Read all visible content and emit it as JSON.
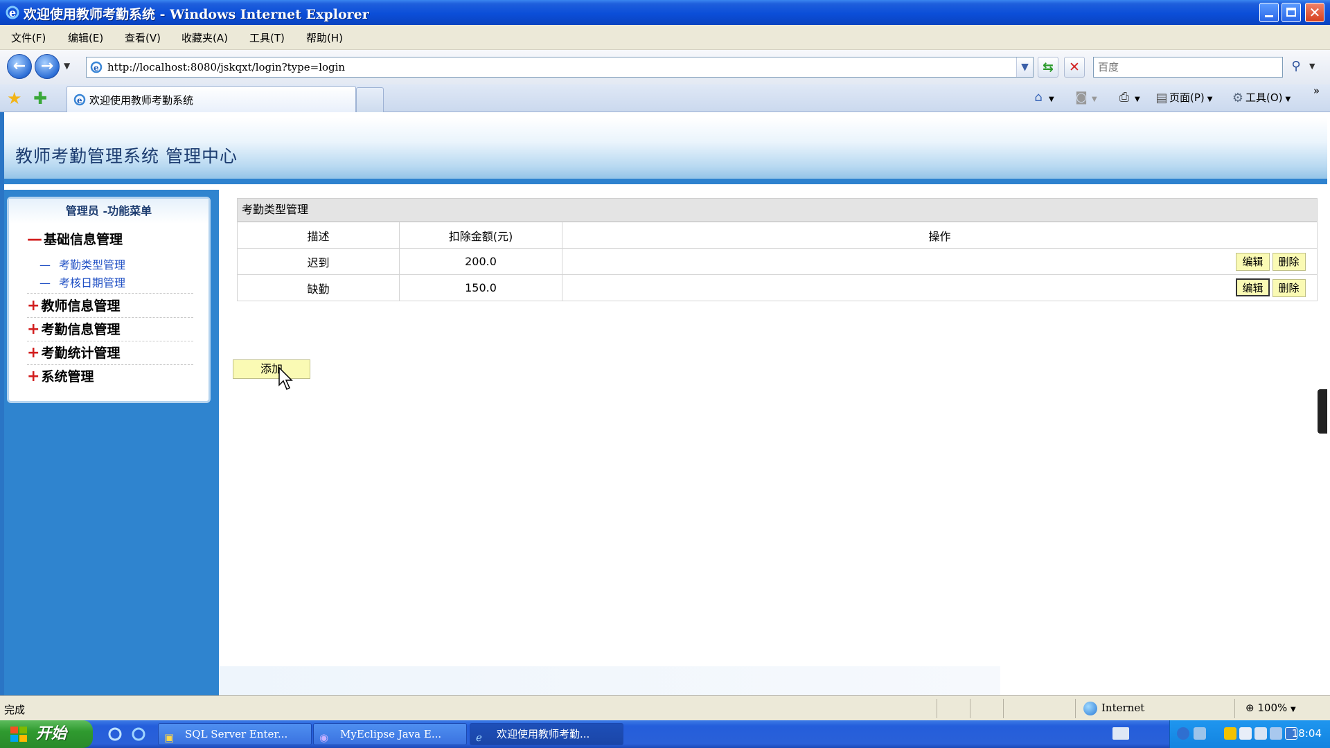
{
  "window": {
    "title": "欢迎使用教师考勤系统 - Windows Internet Explorer"
  },
  "menu": {
    "items": [
      "文件(F)",
      "编辑(E)",
      "查看(V)",
      "收藏夹(A)",
      "工具(T)",
      "帮助(H)"
    ]
  },
  "address": {
    "url": "http://localhost:8080/jskqxt/login?type=login",
    "search_placeholder": "百度"
  },
  "tabs": {
    "active_label": "欢迎使用教师考勤系统"
  },
  "commandbar": {
    "page_label": "页面(P)",
    "tools_label": "工具(O)"
  },
  "page": {
    "title": "教师考勤管理系统 管理中心"
  },
  "sidebar": {
    "header": "管理员 -功能菜单",
    "groups": [
      {
        "mark": "—",
        "label": "基础信息管理",
        "children": [
          "考勤类型管理",
          "考核日期管理"
        ]
      },
      {
        "mark": "+",
        "label": "教师信息管理"
      },
      {
        "mark": "+",
        "label": "考勤信息管理"
      },
      {
        "mark": "+",
        "label": "考勤统计管理"
      },
      {
        "mark": "+",
        "label": "系统管理"
      }
    ],
    "child_dash": "—"
  },
  "panel": {
    "title": "考勤类型管理",
    "columns": [
      "描述",
      "扣除金额(元)",
      "操作"
    ],
    "rows": [
      {
        "desc": "迟到",
        "amount": "200.0",
        "edit": "编辑",
        "delete": "删除"
      },
      {
        "desc": "缺勤",
        "amount": "150.0",
        "edit": "编辑",
        "delete": "删除"
      }
    ],
    "add_label": "添加"
  },
  "status": {
    "text": "完成",
    "zone": "Internet",
    "zoom": "100%"
  },
  "taskbar": {
    "start_label": "开始",
    "tasks": [
      "SQL Server Enter...",
      "MyEclipse Java E...",
      "欢迎使用教师考勤..."
    ],
    "clock": "18:04"
  },
  "colors": {
    "title_bar": "#0b4ed8",
    "page_frame": "#2e82cf",
    "button_yellow": "#fafab4",
    "link_blue": "#1f4fc4",
    "marker_red": "#d21e1e"
  },
  "icons": {
    "browser": "ie-icon",
    "back": "back-arrow-icon",
    "forward": "forward-arrow-icon",
    "refresh": "refresh-icon",
    "stop": "stop-x-icon",
    "search": "magnifier-icon",
    "favorites": "star-icon",
    "home": "home-icon",
    "feeds": "rss-icon",
    "print": "printer-icon",
    "page": "page-icon",
    "tools": "gear-icon",
    "zone": "globe-icon",
    "zoom": "zoom-icon"
  }
}
